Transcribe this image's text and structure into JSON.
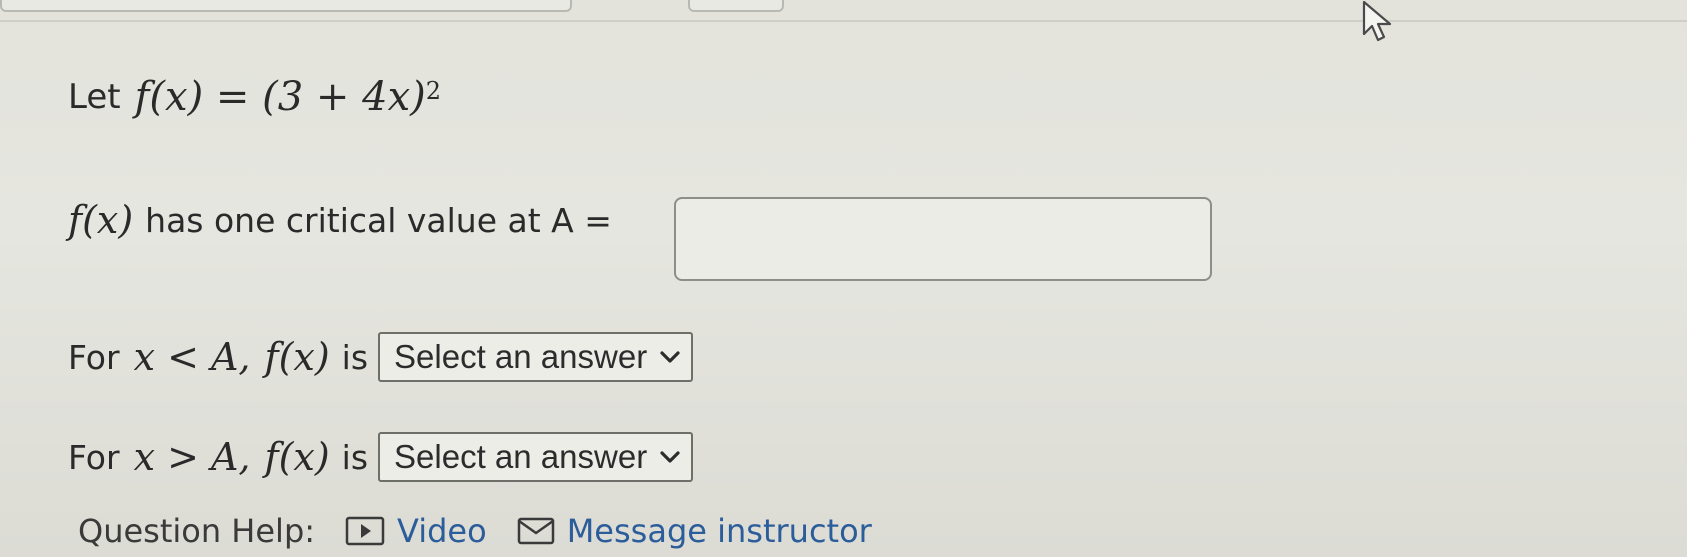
{
  "question": {
    "line1_lead": "Let",
    "function_def": "f(x) = (3 + 4x)",
    "exponent": "2",
    "critical_prefix": "f(x)",
    "critical_text": "has one critical value at A =",
    "answer_value": "",
    "row_less": {
      "lead": "For",
      "condition": "x < A,",
      "fx": "f(x)",
      "is": "is",
      "select_value": "Select an answer"
    },
    "row_greater": {
      "lead": "For",
      "condition": "x > A,",
      "fx": "f(x)",
      "is": "is",
      "select_value": "Select an answer"
    }
  },
  "help": {
    "label": "Question Help:",
    "video_label": "Video",
    "video_icon": "play-icon",
    "message_label": "Message instructor",
    "message_icon": "envelope-icon"
  },
  "colors": {
    "link": "#2c5d9b",
    "background": "#e3e3dc"
  }
}
